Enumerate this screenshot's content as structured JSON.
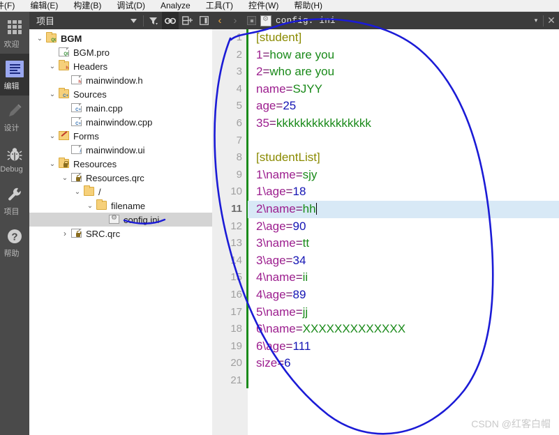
{
  "menubar": {
    "items": [
      {
        "label": "件(F)",
        "name": "menu-file"
      },
      {
        "label": "编辑(E)",
        "name": "menu-edit"
      },
      {
        "label": "构建(B)",
        "name": "menu-build"
      },
      {
        "label": "调试(D)",
        "name": "menu-debug"
      },
      {
        "label": "Analyze",
        "name": "menu-analyze"
      },
      {
        "label": "工具(T)",
        "name": "menu-tools"
      },
      {
        "label": "控件(W)",
        "name": "menu-window"
      },
      {
        "label": "帮助(H)",
        "name": "menu-help"
      }
    ]
  },
  "modebar": {
    "items": [
      {
        "label": "欢迎",
        "icon": "grid-icon",
        "active": false
      },
      {
        "label": "编辑",
        "icon": "edit-document-icon",
        "active": true
      },
      {
        "label": "设计",
        "icon": "pencil-icon",
        "active": false
      },
      {
        "label": "Debug",
        "icon": "bug-icon",
        "active": false
      },
      {
        "label": "项目",
        "icon": "wrench-icon",
        "active": false
      },
      {
        "label": "帮助",
        "icon": "question-mark-icon",
        "active": false
      }
    ]
  },
  "project_panel": {
    "title": "项目",
    "toolbar": [
      {
        "name": "dropdown-arrow-icon",
        "glyph": "▾"
      },
      {
        "name": "filter-icon",
        "glyph": "▼"
      },
      {
        "name": "link-sync-icon",
        "glyph": "⛓"
      },
      {
        "name": "split-view-icon",
        "glyph": "⊟"
      },
      {
        "name": "collapse-panel-icon",
        "glyph": "◧"
      }
    ],
    "tree": [
      {
        "label": "BGM",
        "indent": 0,
        "chev": "⌄",
        "icon": "qt-project-folder",
        "bold": true,
        "selected": false
      },
      {
        "label": "BGM.pro",
        "indent": 1,
        "chev": "",
        "icon": "qt-pro-file",
        "bold": false,
        "selected": false
      },
      {
        "label": "Headers",
        "indent": 1,
        "chev": "⌄",
        "icon": "headers-folder",
        "bold": false,
        "selected": false
      },
      {
        "label": "mainwindow.h",
        "indent": 2,
        "chev": "",
        "icon": "header-file",
        "bold": false,
        "selected": false
      },
      {
        "label": "Sources",
        "indent": 1,
        "chev": "⌄",
        "icon": "sources-folder",
        "bold": false,
        "selected": false
      },
      {
        "label": "main.cpp",
        "indent": 2,
        "chev": "",
        "icon": "cpp-file",
        "bold": false,
        "selected": false
      },
      {
        "label": "mainwindow.cpp",
        "indent": 2,
        "chev": "",
        "icon": "cpp-file",
        "bold": false,
        "selected": false
      },
      {
        "label": "Forms",
        "indent": 1,
        "chev": "⌄",
        "icon": "forms-folder",
        "bold": false,
        "selected": false
      },
      {
        "label": "mainwindow.ui",
        "indent": 2,
        "chev": "",
        "icon": "ui-file",
        "bold": false,
        "selected": false
      },
      {
        "label": "Resources",
        "indent": 1,
        "chev": "⌄",
        "icon": "resources-folder",
        "bold": false,
        "selected": false
      },
      {
        "label": "Resources.qrc",
        "indent": 2,
        "chev": "⌄",
        "icon": "qrc-file",
        "bold": false,
        "selected": false
      },
      {
        "label": "/",
        "indent": 3,
        "chev": "⌄",
        "icon": "folder",
        "bold": false,
        "selected": false
      },
      {
        "label": "filename",
        "indent": 4,
        "chev": "⌄",
        "icon": "folder",
        "bold": false,
        "selected": false
      },
      {
        "label": "config.ini",
        "indent": 5,
        "chev": "",
        "icon": "ini-file",
        "bold": false,
        "selected": true
      },
      {
        "label": "SRC.qrc",
        "indent": 2,
        "chev": "›",
        "icon": "qrc-file",
        "bold": false,
        "selected": false
      }
    ]
  },
  "editor": {
    "tab": {
      "back_glyph": "‹",
      "forward_glyph": "›",
      "filename": "config. ini",
      "dropdown_glyph": "▾",
      "close_glyph": "✕"
    },
    "current_line": 11,
    "total_lines": 21,
    "modified_marker_color": "#1a8a1a",
    "current_line_bg": "#d8e9f6",
    "colors": {
      "section": "#8a8a00",
      "key": "#9c1d8e",
      "string_value": "#1a8a1a",
      "number_value": "#1414b4"
    },
    "lines": [
      {
        "n": 1,
        "tokens": [
          {
            "t": "[student]",
            "c": "sec"
          }
        ]
      },
      {
        "n": 2,
        "tokens": [
          {
            "t": "1",
            "c": "key"
          },
          {
            "t": "=",
            "c": "eq"
          },
          {
            "t": "how are you",
            "c": "str"
          }
        ]
      },
      {
        "n": 3,
        "tokens": [
          {
            "t": "2",
            "c": "key"
          },
          {
            "t": "=",
            "c": "eq"
          },
          {
            "t": "who are you",
            "c": "str"
          }
        ]
      },
      {
        "n": 4,
        "tokens": [
          {
            "t": "name",
            "c": "key"
          },
          {
            "t": "=",
            "c": "eq"
          },
          {
            "t": "SJYY",
            "c": "str"
          }
        ]
      },
      {
        "n": 5,
        "tokens": [
          {
            "t": "age",
            "c": "key"
          },
          {
            "t": "=",
            "c": "eq"
          },
          {
            "t": "25",
            "c": "num"
          }
        ]
      },
      {
        "n": 6,
        "tokens": [
          {
            "t": "35",
            "c": "key"
          },
          {
            "t": "=",
            "c": "eq"
          },
          {
            "t": "kkkkkkkkkkkkkkkk",
            "c": "str"
          }
        ]
      },
      {
        "n": 7,
        "tokens": []
      },
      {
        "n": 8,
        "tokens": [
          {
            "t": "[studentList]",
            "c": "sec"
          }
        ]
      },
      {
        "n": 9,
        "tokens": [
          {
            "t": "1\\name",
            "c": "key"
          },
          {
            "t": "=",
            "c": "eq"
          },
          {
            "t": "sjy",
            "c": "str"
          }
        ]
      },
      {
        "n": 10,
        "tokens": [
          {
            "t": "1\\age",
            "c": "key"
          },
          {
            "t": "=",
            "c": "eq"
          },
          {
            "t": "18",
            "c": "num"
          }
        ]
      },
      {
        "n": 11,
        "tokens": [
          {
            "t": "2\\name",
            "c": "key"
          },
          {
            "t": "=",
            "c": "eq"
          },
          {
            "t": "hh",
            "c": "str"
          }
        ],
        "caret": true
      },
      {
        "n": 12,
        "tokens": [
          {
            "t": "2\\age",
            "c": "key"
          },
          {
            "t": "=",
            "c": "eq"
          },
          {
            "t": "90",
            "c": "num"
          }
        ]
      },
      {
        "n": 13,
        "tokens": [
          {
            "t": "3\\name",
            "c": "key"
          },
          {
            "t": "=",
            "c": "eq"
          },
          {
            "t": "tt",
            "c": "str"
          }
        ]
      },
      {
        "n": 14,
        "tokens": [
          {
            "t": "3\\age",
            "c": "key"
          },
          {
            "t": "=",
            "c": "eq"
          },
          {
            "t": "34",
            "c": "num"
          }
        ]
      },
      {
        "n": 15,
        "tokens": [
          {
            "t": "4\\name",
            "c": "key"
          },
          {
            "t": "=",
            "c": "eq"
          },
          {
            "t": "ii",
            "c": "str"
          }
        ]
      },
      {
        "n": 16,
        "tokens": [
          {
            "t": "4\\age",
            "c": "key"
          },
          {
            "t": "=",
            "c": "eq"
          },
          {
            "t": "89",
            "c": "num"
          }
        ]
      },
      {
        "n": 17,
        "tokens": [
          {
            "t": "5\\name",
            "c": "key"
          },
          {
            "t": "=",
            "c": "eq"
          },
          {
            "t": "jj",
            "c": "str"
          }
        ]
      },
      {
        "n": 18,
        "tokens": [
          {
            "t": "6\\name",
            "c": "key"
          },
          {
            "t": "=",
            "c": "eq"
          },
          {
            "t": "XXXXXXXXXXXXX",
            "c": "str"
          }
        ]
      },
      {
        "n": 19,
        "tokens": [
          {
            "t": "6\\age",
            "c": "key"
          },
          {
            "t": "=",
            "c": "eq"
          },
          {
            "t": "111",
            "c": "num"
          }
        ]
      },
      {
        "n": 20,
        "tokens": [
          {
            "t": "size",
            "c": "key"
          },
          {
            "t": "=",
            "c": "eq"
          },
          {
            "t": "6",
            "c": "num"
          }
        ]
      },
      {
        "n": 21,
        "tokens": []
      }
    ]
  },
  "annotations": {
    "color": "#1b1bd6",
    "shapes": [
      "big-ellipse-around-code",
      "underline-under-config-ini"
    ]
  },
  "watermark": {
    "text": "CSDN @红客白帽"
  }
}
